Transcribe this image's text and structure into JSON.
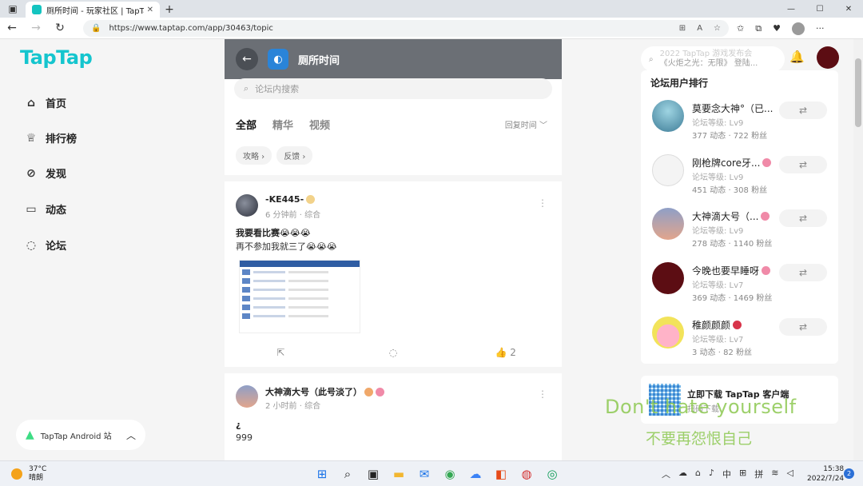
{
  "browser": {
    "tab_title": "厕所时间 - 玩家社区 | TapTap 社区",
    "url_prefix": "https://",
    "url_host": "www.taptap.com",
    "url_path": "/app/30463/topic"
  },
  "sidebar": {
    "logo": "TapTap",
    "items": [
      {
        "label": "首页",
        "icon": "home-icon"
      },
      {
        "label": "排行榜",
        "icon": "trophy-icon"
      },
      {
        "label": "发现",
        "icon": "compass-icon"
      },
      {
        "label": "动态",
        "icon": "chat-icon"
      },
      {
        "label": "论坛",
        "icon": "forum-icon"
      }
    ],
    "android_label": "TapTap Android 站"
  },
  "header": {
    "search_line1": "2022 TapTap 游戏发布会",
    "search_line2": "《火炬之光：无限》 登陆..."
  },
  "forum": {
    "title": "厕所时间",
    "search_placeholder": "论坛内搜索",
    "tabs": [
      "全部",
      "精华",
      "视频"
    ],
    "sort_label": "回复时间",
    "chips": [
      "攻略",
      "反馈"
    ]
  },
  "posts": [
    {
      "author": "-KE445-",
      "meta": "6 分钟前 · 综合",
      "title": "我要看比赛😭😭😭",
      "body": "再不参加我就三了😭😭😭",
      "likes": "2"
    },
    {
      "author": "大神滴大号（此号淡了）",
      "meta": "2 小时前 · 综合",
      "title": "¿",
      "body": "999"
    }
  ],
  "ranking": {
    "title": "论坛用户排行",
    "users": [
      {
        "name": "莫要念大神°（已...",
        "level": "论坛等级: Lv9",
        "stats": "377 动态 · 722 粉丝"
      },
      {
        "name": "刚枪牌core牙...",
        "level": "论坛等级: Lv9",
        "stats": "451 动态 · 308 粉丝"
      },
      {
        "name": "大神滴大号（...",
        "level": "论坛等级: Lv9",
        "stats": "278 动态 · 1140 粉丝"
      },
      {
        "name": "今晚也要早睡呀",
        "level": "论坛等级: Lv7",
        "stats": "369 动态 · 1469 粉丝"
      },
      {
        "name": "稚颜颜颜",
        "level": "论坛等级: Lv7",
        "stats": "3 动态 · 82 粉丝"
      }
    ]
  },
  "download": {
    "title": "立即下载 TapTap 客户端",
    "subtitle": "扫码下载"
  },
  "subtitles": {
    "en": "Don't hate yourself",
    "zh": "不要再怨恨自己"
  },
  "taskbar": {
    "temperature": "37°C",
    "weather": "晴朗",
    "ime_lang": "中",
    "ime_mode": "拼",
    "time": "15:38",
    "date": "2022/7/24",
    "notifications": "2"
  }
}
